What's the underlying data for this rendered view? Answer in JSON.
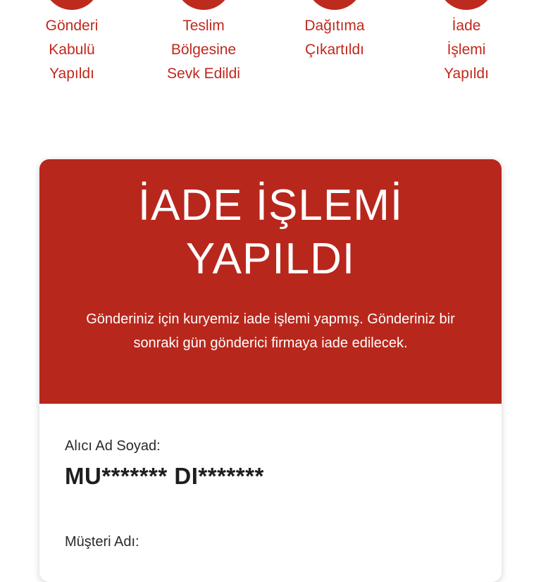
{
  "steps": [
    {
      "label": "Gönderi\nKabulü\nYapıldı"
    },
    {
      "label": "Teslim\nBölgesine\nSevk Edildi"
    },
    {
      "label": "Dağıtıma\nÇıkartıldı"
    },
    {
      "label": "İade\nİşlemi\nYapıldı"
    }
  ],
  "card": {
    "title": "İADE İŞLEMİ\nYAPILDI",
    "description": "Gönderiniz için kuryemiz iade işlemi yapmış. Gönderiniz bir sonraki gün gönderici firmaya iade edilecek."
  },
  "recipient": {
    "label": "Alıcı Ad Soyad:",
    "value": "MU******* DI*******"
  },
  "customer": {
    "label": "Müşteri Adı:"
  },
  "colors": {
    "accent": "#b8271c",
    "step_text": "#c0281d"
  }
}
